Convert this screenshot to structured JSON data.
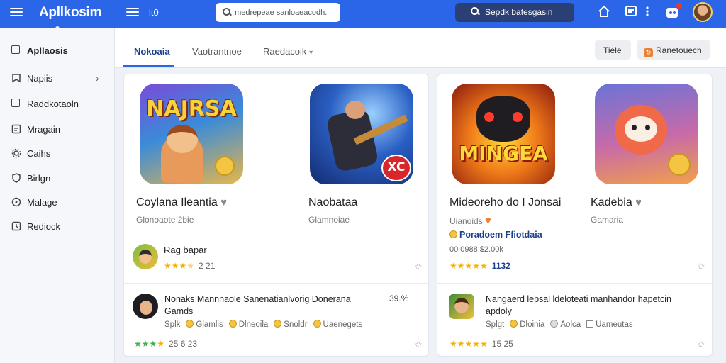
{
  "topbar": {
    "brand": "Apllkosim",
    "label": "lt0",
    "search_placeholder": "medrepeae sanloaeacodh.",
    "search2_placeholder": "Sepdk batesgasin"
  },
  "sidebar": {
    "items": [
      {
        "label": "Apllaosis",
        "icon": "square-icon"
      },
      {
        "label": "Napiis",
        "icon": "bookmark-icon"
      },
      {
        "label": "Raddkotaoln",
        "icon": "square-icon"
      },
      {
        "label": "Mragain",
        "icon": "image-icon"
      },
      {
        "label": "Caihs",
        "icon": "settings-icon"
      },
      {
        "label": "Birlgn",
        "icon": "shield-icon"
      },
      {
        "label": "Malage",
        "icon": "compass-icon"
      },
      {
        "label": "Rediock",
        "icon": "history-icon"
      }
    ]
  },
  "tabs": [
    {
      "label": "Nokoaia"
    },
    {
      "label": "Vaotrantnoe"
    },
    {
      "label": "Raedacoik"
    }
  ],
  "actions": {
    "filter_label": "Tiele",
    "refresh_label": "Ranetouech"
  },
  "apps": [
    {
      "art_text": "NAJRSA",
      "title": "Coylana Ileantia",
      "subtitle": "Glonoaote 2bie"
    },
    {
      "art_text": "XC",
      "title": "Naobataa",
      "subtitle": "Glamnoiae"
    },
    {
      "art_text": "MINGEA",
      "title": "Mideoreho do I Jonsai",
      "subtitle": "Uianoids",
      "promo": "Poradoem Ffiotdaia",
      "meta": "00 0988 $2.00k"
    },
    {
      "art_text": "",
      "title": "Kadebia",
      "subtitle": "Gamaria"
    }
  ],
  "rows": [
    {
      "title": "Rag bapar",
      "rating_text": "2 21"
    },
    {
      "title": "",
      "rating_text": "1132"
    },
    {
      "title": "Nonaks Mannnaole Sanenatianlvorig Donerana Gamds",
      "size": "39.%",
      "tags": [
        "Splk",
        "Glamlis",
        "Dlneoila",
        "Snoldr",
        "Uaenegets"
      ],
      "rating_text": "25 6 23"
    },
    {
      "title": "Nangaerd lebsal ldeloteati manhandor hapetcin apdoly",
      "tags": [
        "Splgt",
        "Dloinia",
        "Aolca",
        "Uameutas"
      ],
      "rating_text": "15 25"
    }
  ],
  "colors": {
    "primary": "#2c66e8",
    "star": "#f4b400",
    "star_green": "#3bb34a"
  }
}
